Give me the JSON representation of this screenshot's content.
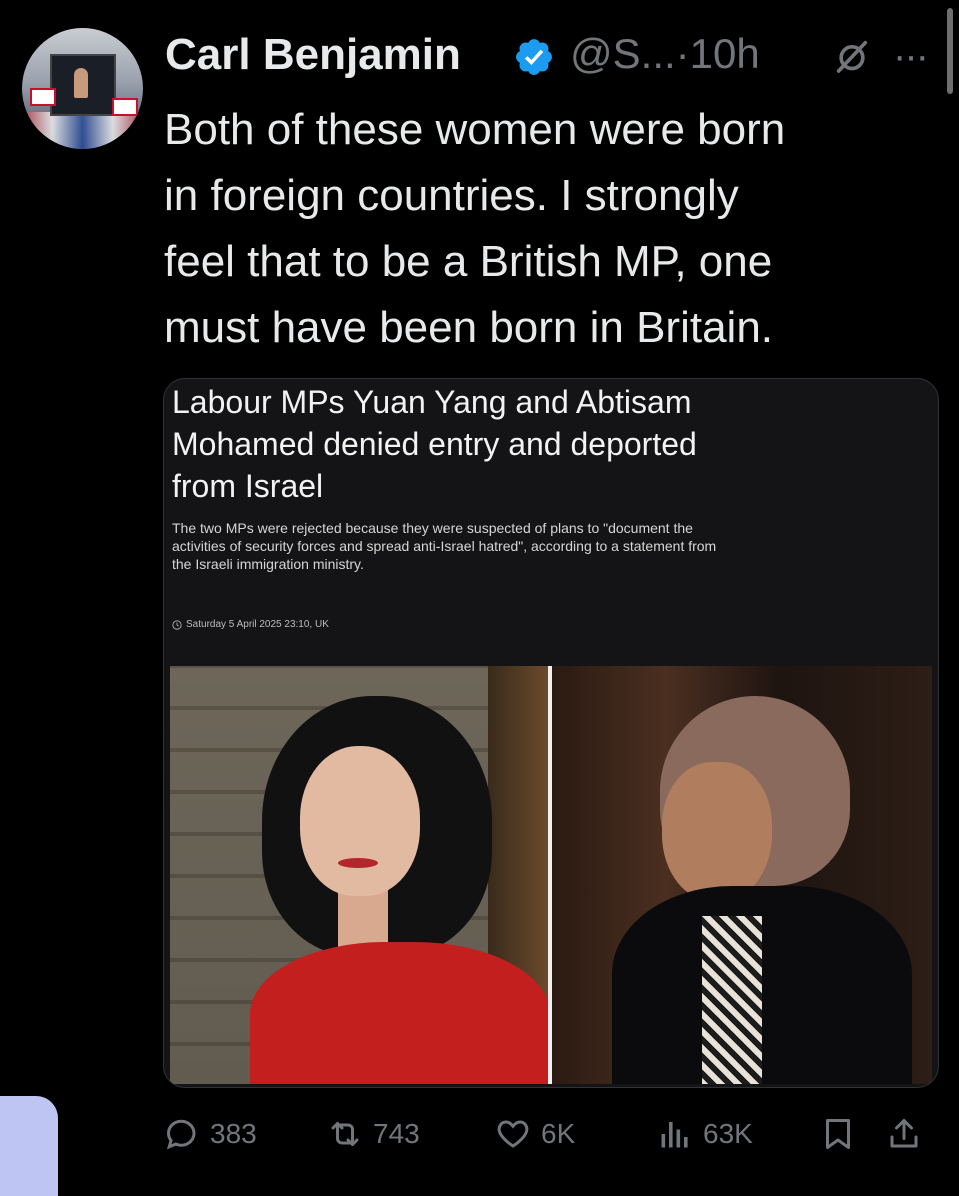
{
  "author": {
    "name": "Carl Benjamin",
    "handle": "@S...",
    "separator": "·",
    "time": "10h",
    "more": "···"
  },
  "tweet": {
    "lines": [
      "Both of these women were born",
      "in foreign countries. I strongly",
      "feel that to be a British MP, one",
      "must have been born in Britain."
    ]
  },
  "card": {
    "headline_lines": [
      "Labour MPs Yuan Yang and Abtisam",
      "Mohamed denied entry and deported",
      "from Israel"
    ],
    "standfirst_lines": [
      "The two MPs were rejected because they were suspected of plans to \"document the",
      "activities of security forces and spread anti-Israel hatred\", according to a statement from",
      "the Israeli immigration ministry."
    ],
    "dateline": "Saturday 5 April 2025 23:10, UK"
  },
  "actions": {
    "replies": "383",
    "reposts": "743",
    "likes": "6K",
    "views": "63K"
  },
  "icons": {
    "verified": "verified-badge-icon",
    "grok": "grok-icon",
    "reply": "reply-icon",
    "repost": "repost-icon",
    "like": "heart-icon",
    "views": "views-icon",
    "bookmark": "bookmark-icon",
    "share": "share-icon"
  },
  "colors": {
    "background": "#000000",
    "text": "#e7e9ea",
    "muted": "#71767b",
    "verified": "#1d9bf0"
  }
}
